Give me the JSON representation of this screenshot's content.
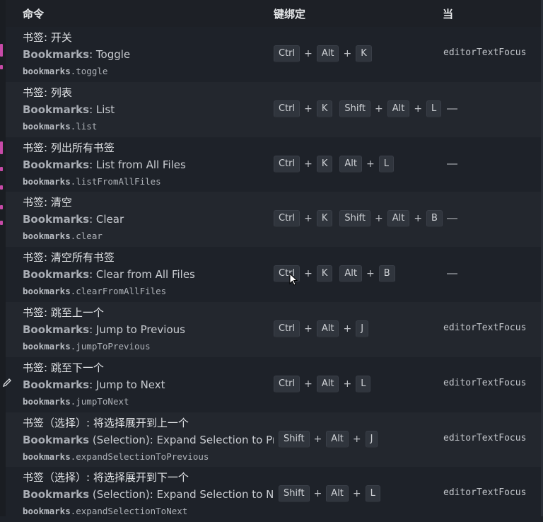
{
  "header": {
    "command": "命令",
    "keybinding": "键绑定",
    "when": "当"
  },
  "rows": [
    {
      "zh": "书签: 开关",
      "en_prefix": "Bookmarks",
      "en_sep": ": ",
      "en_suffix": "Toggle",
      "cmd_prefix": "bookmarks",
      "cmd_rest": ".toggle",
      "chords": [
        [
          "Ctrl",
          "Alt",
          "K"
        ]
      ],
      "when": "editorTextFocus"
    },
    {
      "zh": "书签: 列表",
      "en_prefix": "Bookmarks",
      "en_sep": ": ",
      "en_suffix": "List",
      "cmd_prefix": "bookmarks",
      "cmd_rest": ".list",
      "chords": [
        [
          "Ctrl",
          "K"
        ],
        [
          "Shift",
          "Alt",
          "L"
        ]
      ],
      "when": "—"
    },
    {
      "zh": "书签: 列出所有书签",
      "en_prefix": "Bookmarks",
      "en_sep": ": ",
      "en_suffix": "List from All Files",
      "cmd_prefix": "bookmarks",
      "cmd_rest": ".listFromAllFiles",
      "chords": [
        [
          "Ctrl",
          "K"
        ],
        [
          "Alt",
          "L"
        ]
      ],
      "when": "—"
    },
    {
      "zh": "书签: 清空",
      "en_prefix": "Bookmarks",
      "en_sep": ": ",
      "en_suffix": "Clear",
      "cmd_prefix": "bookmarks",
      "cmd_rest": ".clear",
      "chords": [
        [
          "Ctrl",
          "K"
        ],
        [
          "Shift",
          "Alt",
          "B"
        ]
      ],
      "when": "—"
    },
    {
      "zh": "书签: 清空所有书签",
      "en_prefix": "Bookmarks",
      "en_sep": ": ",
      "en_suffix": "Clear from All Files",
      "cmd_prefix": "bookmarks",
      "cmd_rest": ".clearFromAllFiles",
      "chords": [
        [
          "Ctrl",
          "K"
        ],
        [
          "Alt",
          "B"
        ]
      ],
      "when": "—"
    },
    {
      "zh": "书签: 跳至上一个",
      "en_prefix": "Bookmarks",
      "en_sep": ": ",
      "en_suffix": "Jump to Previous",
      "cmd_prefix": "bookmarks",
      "cmd_rest": ".jumpToPrevious",
      "chords": [
        [
          "Ctrl",
          "Alt",
          "J"
        ]
      ],
      "when": "editorTextFocus"
    },
    {
      "zh": "书签: 跳至下一个",
      "en_prefix": "Bookmarks",
      "en_sep": ": ",
      "en_suffix": "Jump to Next",
      "cmd_prefix": "bookmarks",
      "cmd_rest": ".jumpToNext",
      "chords": [
        [
          "Ctrl",
          "Alt",
          "L"
        ]
      ],
      "when": "editorTextFocus"
    },
    {
      "zh": "书签（选择）: 将选择展开到上一个",
      "en_prefix": "Bookmarks",
      "en_sep": " ",
      "en_suffix": "(Selection): Expand Selection to Pre",
      "cmd_prefix": "bookmarks",
      "cmd_rest": ".expandSelectionToPrevious",
      "chords": [
        [
          "Shift",
          "Alt",
          "J"
        ]
      ],
      "when": "editorTextFocus"
    },
    {
      "zh": "书签（选择）: 将选择展开到下一个",
      "en_prefix": "Bookmarks",
      "en_sep": " ",
      "en_suffix": "(Selection): Expand Selection to Nex",
      "cmd_prefix": "bookmarks",
      "cmd_rest": ".expandSelectionToNext",
      "chords": [
        [
          "Shift",
          "Alt",
          "L"
        ]
      ],
      "when": "editorTextFocus"
    }
  ]
}
